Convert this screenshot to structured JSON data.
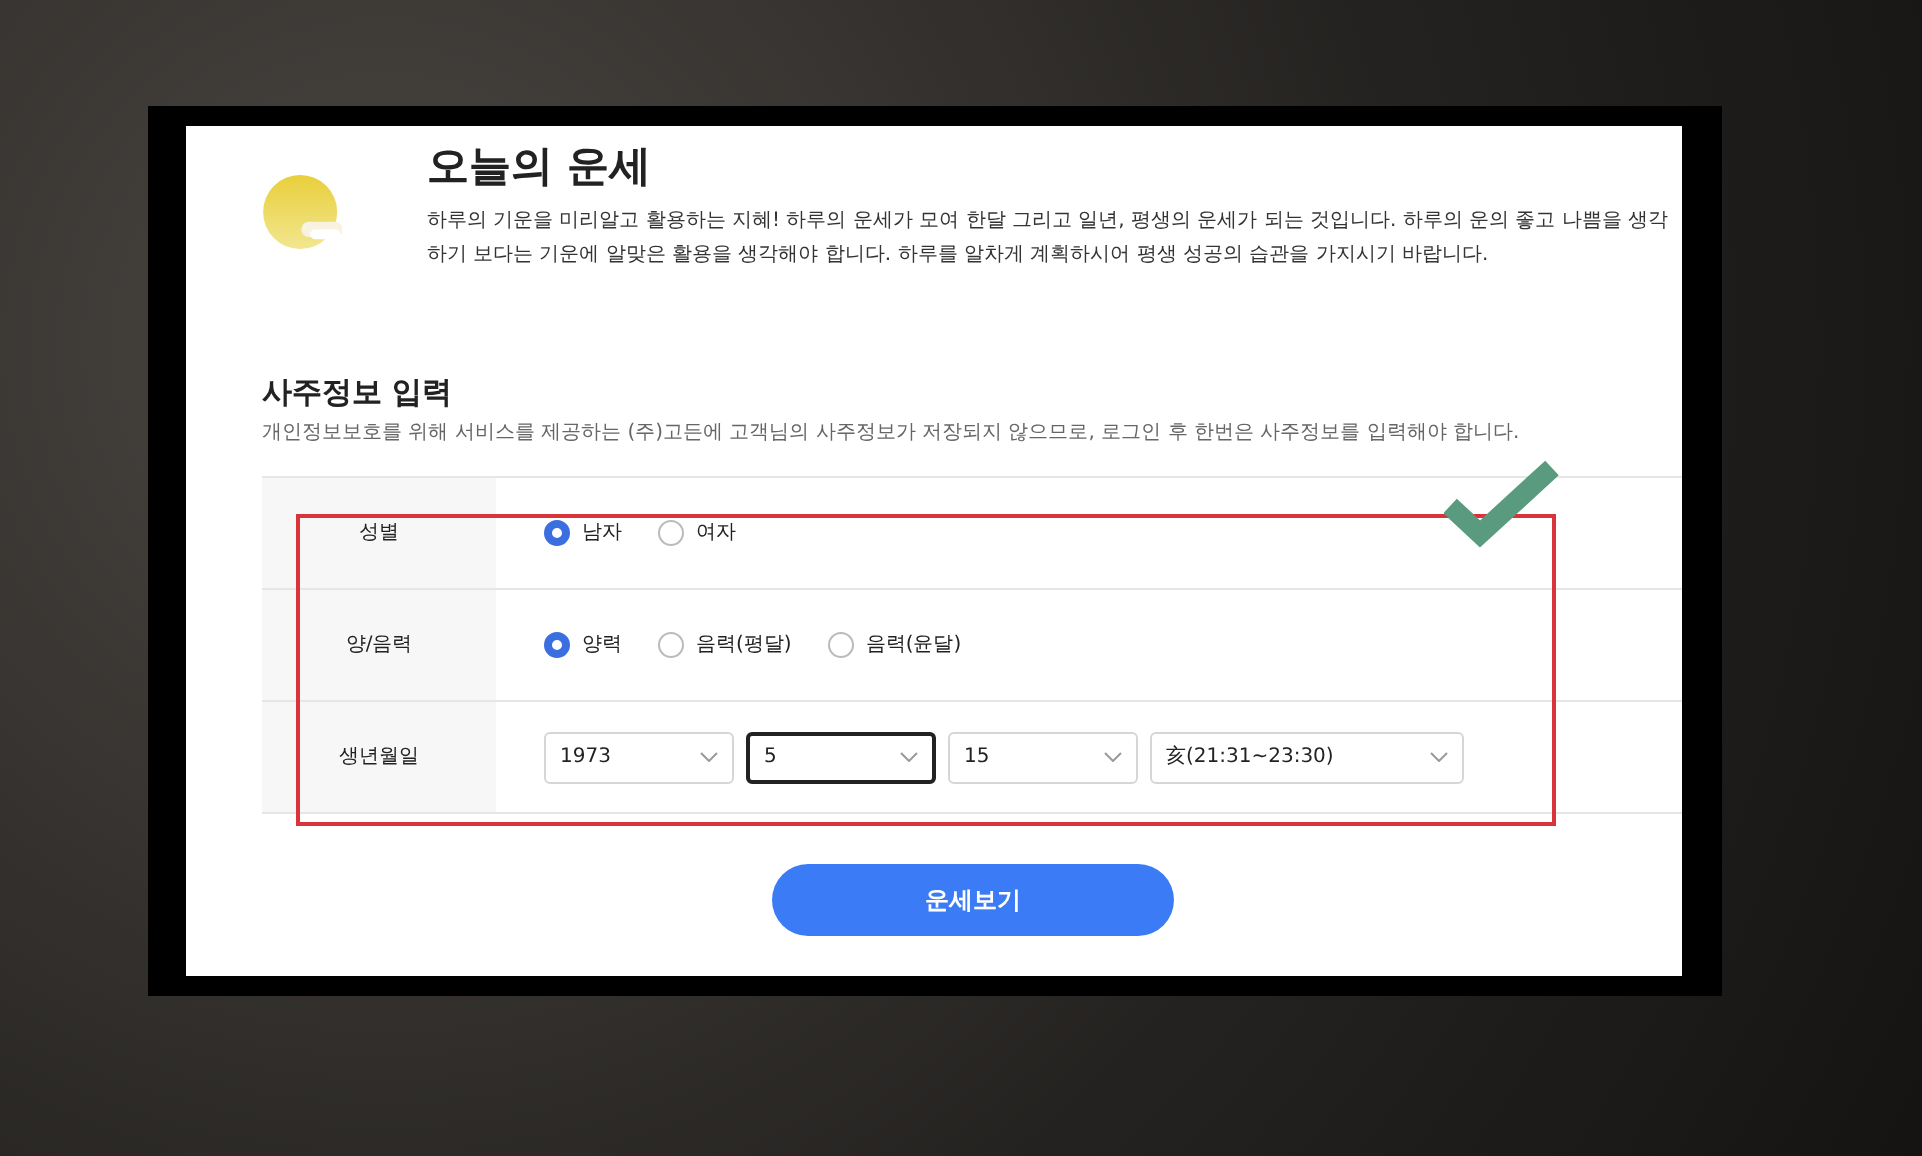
{
  "header": {
    "title": "오늘의 운세",
    "description": "하루의 기운을 미리알고 활용하는 지혜! 하루의 운세가 모여 한달 그리고 일년, 평생의 운세가 되는 것입니다. 하루의 운의 좋고 나쁨을 생각하기 보다는 기운에 알맞은 활용을 생각해야 합니다. 하루를 알차게 계획하시어 평생 성공의 습관을 가지시기 바랍니다."
  },
  "section": {
    "title": "사주정보 입력",
    "notice": "개인정보보호를 위해 서비스를 제공하는 (주)고든에 고객님의 사주정보가 저장되지 않으므로, 로그인 후 한번은 사주정보를 입력해야 합니다."
  },
  "form": {
    "rows": [
      {
        "label": "성별",
        "kind": "radio",
        "options": [
          {
            "label": "남자",
            "selected": true
          },
          {
            "label": "여자",
            "selected": false
          }
        ]
      },
      {
        "label": "양/음력",
        "kind": "radio",
        "options": [
          {
            "label": "양력",
            "selected": true
          },
          {
            "label": "음력(평달)",
            "selected": false
          },
          {
            "label": "음력(윤달)",
            "selected": false
          }
        ]
      },
      {
        "label": "생년월일",
        "kind": "select",
        "selects": [
          {
            "value": "1973",
            "focused": false
          },
          {
            "value": "5",
            "focused": true
          },
          {
            "value": "15",
            "focused": false
          },
          {
            "value": "亥(21:31~23:30)",
            "focused": false
          }
        ]
      }
    ]
  },
  "submit_button": "운세보기"
}
